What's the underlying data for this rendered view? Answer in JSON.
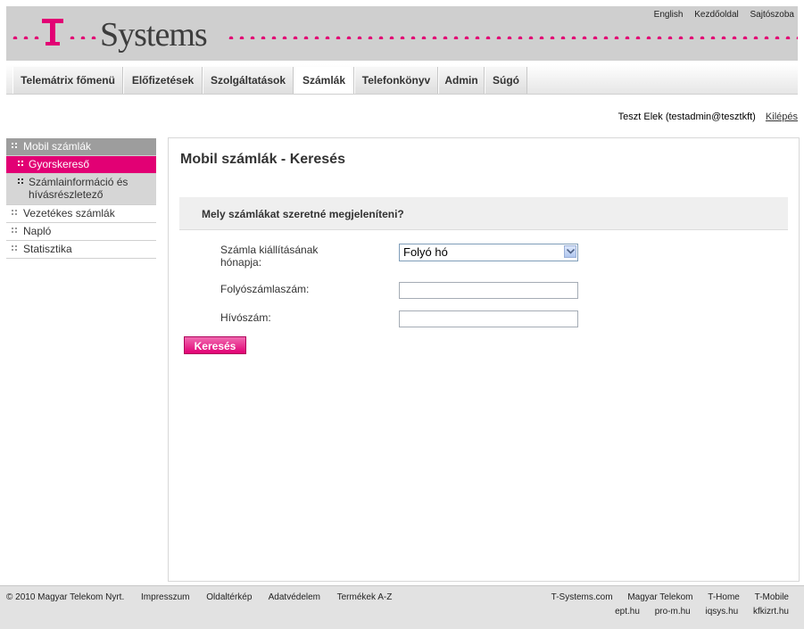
{
  "header": {
    "brand": "Systems",
    "top_links": [
      "English",
      "Kezdőoldal",
      "Sajtószoba"
    ]
  },
  "nav": {
    "items": [
      "Telemátrix főmenü",
      "Előfizetések",
      "Szolgáltatások",
      "Számlák",
      "Telefonkönyv",
      "Admin",
      "Súgó"
    ],
    "active": "Számlák"
  },
  "user": {
    "name": "Teszt Elek (testadmin@tesztkft)",
    "logout": "Kilépés"
  },
  "sidebar": {
    "items": [
      {
        "label": "Mobil számlák",
        "state": "header"
      },
      {
        "label": "Gyorskereső",
        "state": "active"
      },
      {
        "label": "Számlainformáció és hívásrészletező",
        "state": "sub"
      },
      {
        "label": "Vezetékes számlák",
        "state": "normal"
      },
      {
        "label": "Napló",
        "state": "normal"
      },
      {
        "label": "Statisztika",
        "state": "normal"
      }
    ]
  },
  "main": {
    "title": "Mobil számlák - Keresés",
    "question": "Mely számlákat szeretné megjeleníteni?",
    "fields": {
      "month_label": "Számla kiállításának hónapja:",
      "month_value": "Folyó hó",
      "account_label": "Folyószámlaszám:",
      "account_value": "",
      "phone_label": "Hívószám:",
      "phone_value": ""
    },
    "search_button": "Keresés"
  },
  "footer": {
    "left": [
      "© 2010 Magyar Telekom Nyrt.",
      "Impresszum",
      "Oldaltérkép",
      "Adatvédelem",
      "Termékek A-Z"
    ],
    "right_row1": [
      "T-Systems.com",
      "Magyar Telekom",
      "T-Home",
      "T-Mobile"
    ],
    "right_row2": [
      "ept.hu",
      "pro-m.hu",
      "iqsys.hu",
      "kfkizrt.hu"
    ]
  },
  "colors": {
    "accent": "#e20074",
    "header_bg": "#cfcfcf",
    "sidebar_header": "#9d9d9d"
  }
}
